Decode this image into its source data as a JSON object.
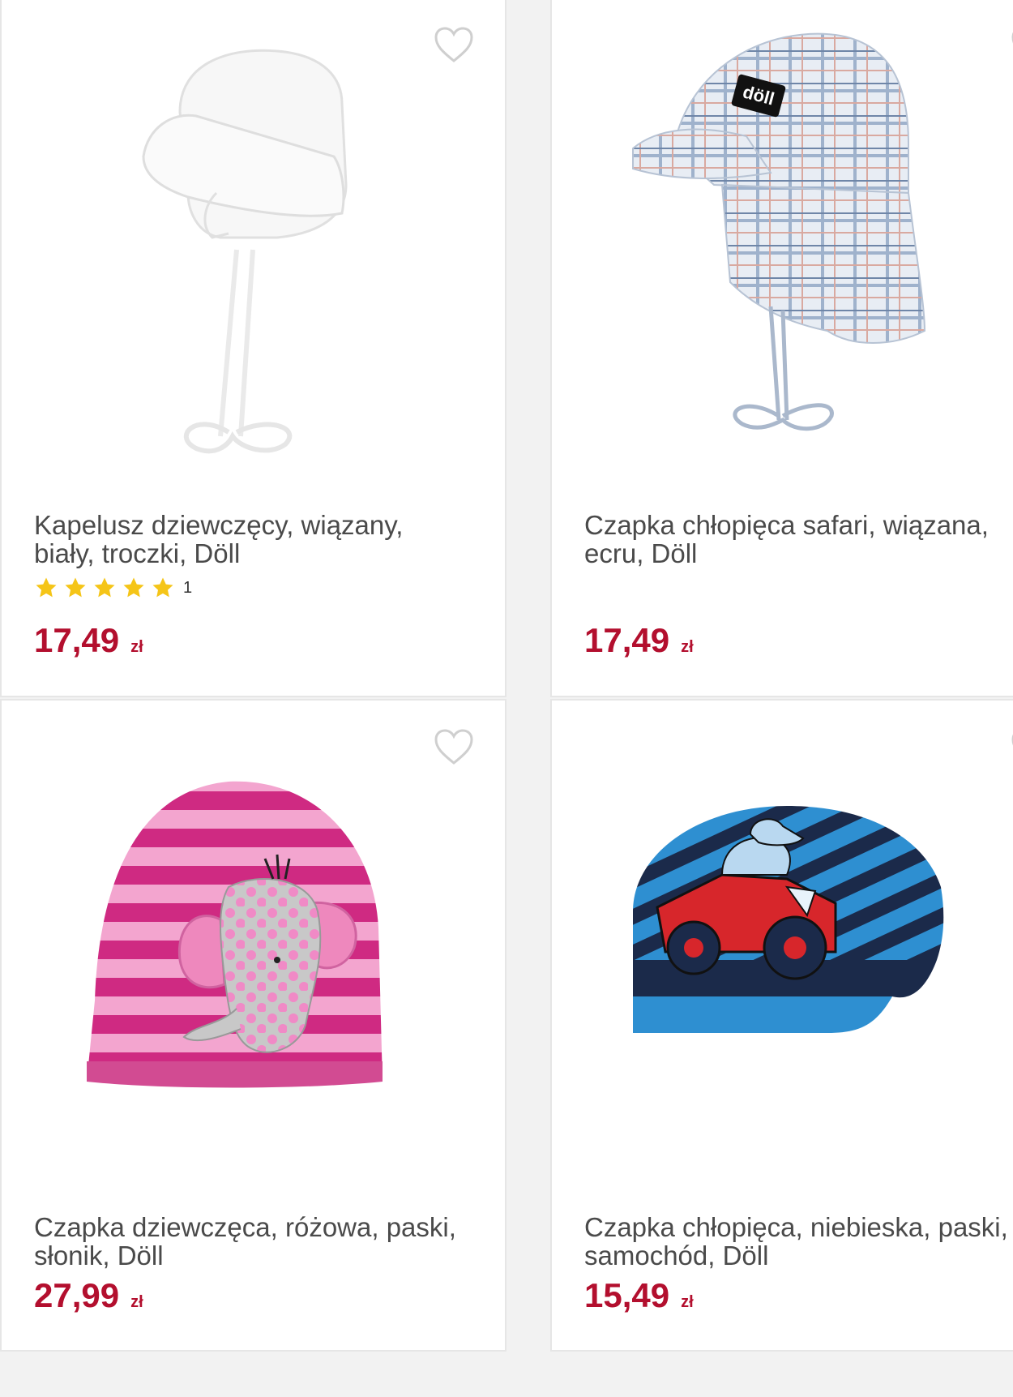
{
  "colors": {
    "price": "#b30f2e",
    "star": "#f5c518",
    "title": "#4a4a4a"
  },
  "products": [
    {
      "title": "Kapelusz dziewczęcy, wiązany,\nbiały, troczki, Döll",
      "rating": {
        "stars": 5,
        "count": "1"
      },
      "price": "17,49",
      "currency": "zł",
      "image_icon": "white-hat-image"
    },
    {
      "title": "Czapka chłopięca safari, wiązana,\necru, Döll",
      "price": "17,49",
      "currency": "zł",
      "image_icon": "plaid-cap-image",
      "logo_text": "döll"
    },
    {
      "title": "Czapka dziewczęca, różowa, paski,\nsłonik, Döll",
      "price": "27,99",
      "currency": "zł",
      "image_icon": "pink-elephant-beanie-image"
    },
    {
      "title": "Czapka chłopięca, niebieska, paski,\nsamochód, Döll",
      "price": "15,49",
      "currency": "zł",
      "image_icon": "blue-car-cap-image"
    }
  ]
}
